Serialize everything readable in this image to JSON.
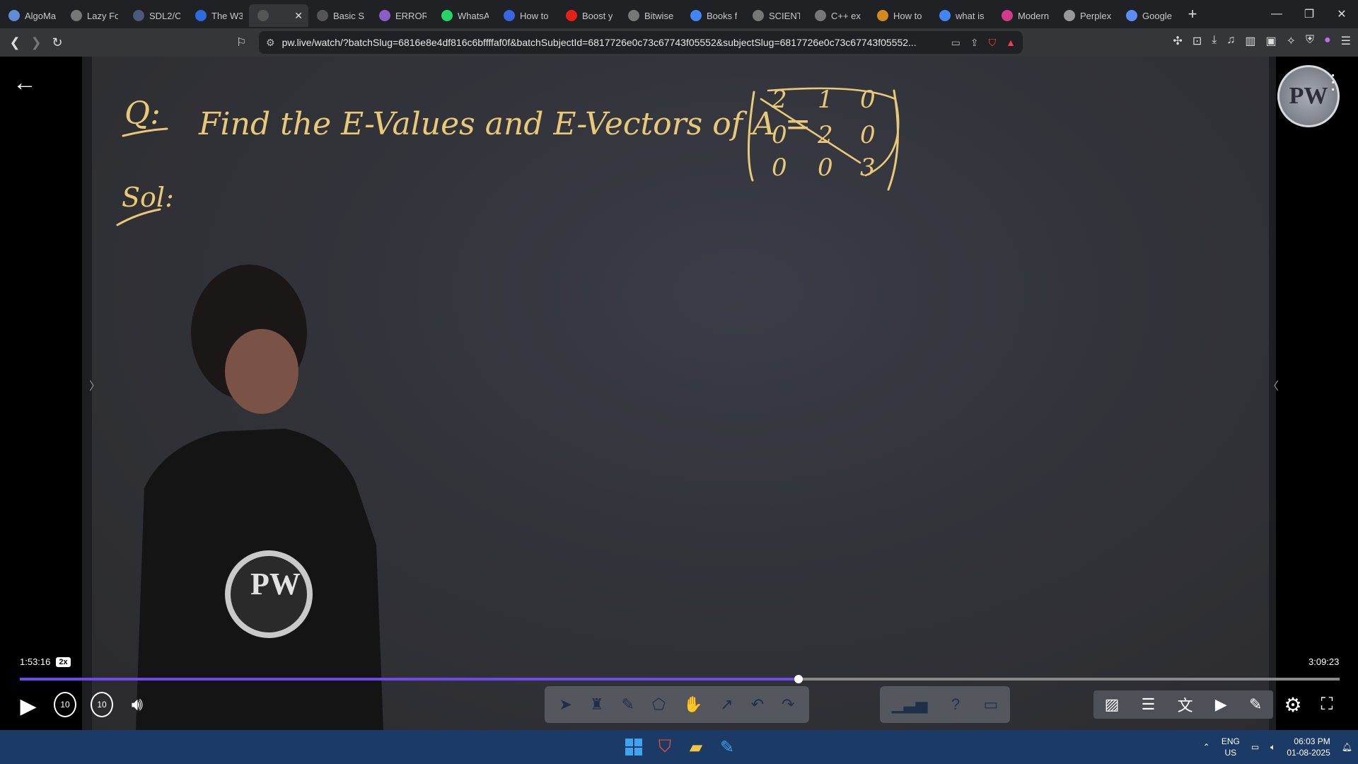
{
  "browser": {
    "tabs": [
      {
        "label": "AlgoMa",
        "favicon": "algo-icon",
        "color": "#5f8cd6"
      },
      {
        "label": "Lazy Fo",
        "favicon": "globe-icon",
        "color": "#777777"
      },
      {
        "label": "SDL2/C",
        "favicon": "sdl-icon",
        "color": "#4b5a7a"
      },
      {
        "label": "The W3",
        "favicon": "w3-icon",
        "color": "#2d6cdf"
      },
      {
        "label": "",
        "favicon": "audio-icon",
        "color": "#555555",
        "active": true
      },
      {
        "label": "Basic Sy",
        "favicon": "page-icon",
        "color": "#555555"
      },
      {
        "label": "ERROR",
        "favicon": "error-icon",
        "color": "#8a5ec8"
      },
      {
        "label": "WhatsA",
        "favicon": "whatsapp-icon",
        "color": "#25d366"
      },
      {
        "label": "How to",
        "favicon": "bookmark-icon",
        "color": "#3a64e0"
      },
      {
        "label": "Boost y",
        "favicon": "youtube-icon",
        "color": "#e62117"
      },
      {
        "label": "Bitwise",
        "favicon": "code-icon",
        "color": "#777777"
      },
      {
        "label": "Books f",
        "favicon": "google-icon",
        "color": "#4285f4"
      },
      {
        "label": "SCIENT",
        "favicon": "globe-icon",
        "color": "#777777"
      },
      {
        "label": "C++ ex",
        "favicon": "openai-icon",
        "color": "#777777"
      },
      {
        "label": "How to",
        "favicon": "book-icon",
        "color": "#d18b1f"
      },
      {
        "label": "what is",
        "favicon": "google-icon",
        "color": "#4285f4"
      },
      {
        "label": "Modern",
        "favicon": "m-icon",
        "color": "#d23b8a"
      },
      {
        "label": "Perplex",
        "favicon": "perplexity-icon",
        "color": "#999999"
      },
      {
        "label": "Google",
        "favicon": "gemini-icon",
        "color": "#5c8df6"
      }
    ],
    "active_tab_close": "✕",
    "new_tab": "+",
    "url": "pw.live/watch/?batchSlug=6816e8e4df816c6bffffaf0f&batchSubjectId=6817726e0c73c67743f05552&subjectSlug=6817726e0c73c67743f05552..."
  },
  "player": {
    "current_time": "1:53:16",
    "speed": "2x",
    "total_time": "3:09:23",
    "progress": 0.59,
    "seek_back": "10",
    "seek_forward": "10"
  },
  "board": {
    "question_label": "Q:",
    "question_text": "Find the E-Values and E-Vectors of A =",
    "matrix": [
      [
        "2",
        "1",
        "0"
      ],
      [
        "0",
        "2",
        "0"
      ],
      [
        "0",
        "0",
        "3"
      ]
    ],
    "solution_label": "Sol:",
    "ink_color": "#e8c977",
    "logo_text": "PW"
  },
  "taskbar": {
    "lang_top": "ENG",
    "lang_bottom": "US",
    "time": "06:03 PM",
    "date": "01-08-2025"
  }
}
